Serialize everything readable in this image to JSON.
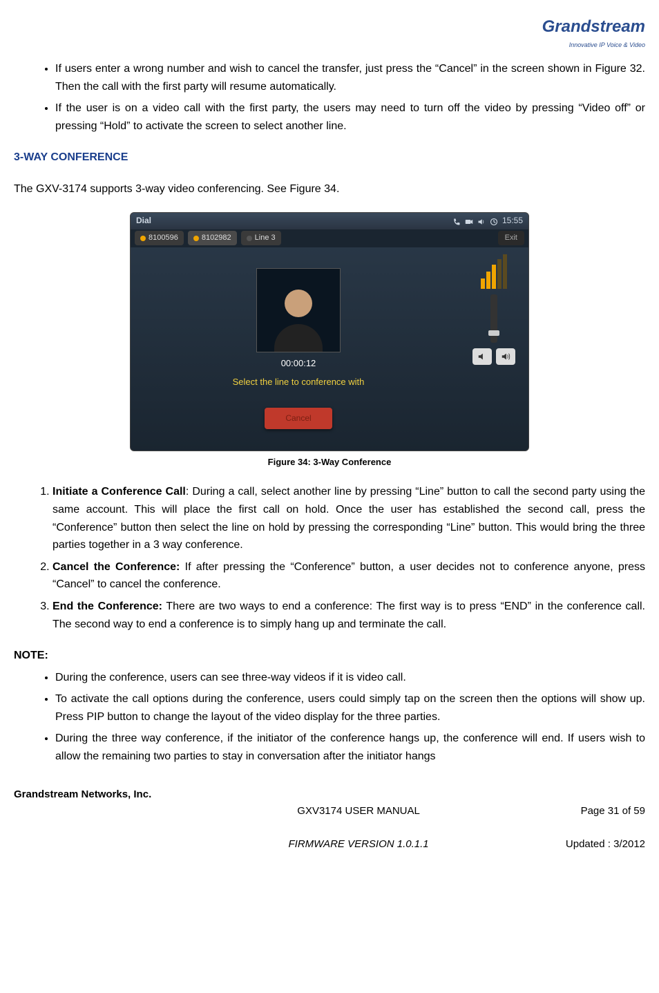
{
  "logo": {
    "name": "Grandstream",
    "tagline": "Innovative IP Voice & Video"
  },
  "top_bullets": [
    "If users enter a wrong number and wish to cancel the transfer, just press the “Cancel” in the screen shown in Figure 32. Then the call with the first party will resume automatically.",
    "If the user is on a video call with the first party, the users may need to turn off the video by pressing “Video off” or pressing “Hold” to activate the screen to select another line."
  ],
  "section_title": "3-WAY CONFERENCE",
  "intro_para": "The GXV-3174 supports 3-way video conferencing. See Figure 34.",
  "screenshot": {
    "title": "Dial",
    "time": "15:55",
    "tabs": [
      "8100596",
      "8102982",
      "Line 3"
    ],
    "exit": "Exit",
    "timer": "00:00:12",
    "prompt": "Select the line to conference with",
    "cancel": "Cancel"
  },
  "figure_caption": "Figure 34: 3-Way Conference",
  "numbered": [
    {
      "lead": "Initiate a Conference Call",
      "sep": ": ",
      "text": "During a call, select another line by pressing “Line” button to call the second party using the same account. This will place the first call on hold. Once the user has established the second call, press the “Conference” button then select the line on hold by pressing the corresponding “Line” button. This would bring the three parties together in a 3 way conference."
    },
    {
      "lead": "Cancel the Conference:",
      "sep": " ",
      "text": "If after pressing the “Conference” button, a user decides not to conference anyone, press “Cancel” to cancel the conference."
    },
    {
      "lead": "End the Conference:",
      "sep": " ",
      "text": "There are two ways to end a conference: The first way is to press “END” in the conference call. The second way to end a conference is to simply hang up and terminate the call."
    }
  ],
  "note_label": "NOTE:",
  "note_bullets": [
    "During the conference, users can see three-way videos if it is video call.",
    "To activate the call options during the conference, users could simply tap on the screen then the options will show up. Press PIP button to change the layout of the video display for the three parties.",
    "During the three way conference, if the initiator of the conference hangs up, the conference will end. If users wish to allow the remaining two parties to stay in conversation after the initiator hangs"
  ],
  "footer": {
    "left": "Grandstream Networks, Inc.",
    "center_line1": "GXV3174 USER MANUAL",
    "center_line2": "FIRMWARE VERSION 1.0.1.1",
    "right_line1": "Page 31 of 59",
    "right_line2": "Updated : 3/2012"
  }
}
